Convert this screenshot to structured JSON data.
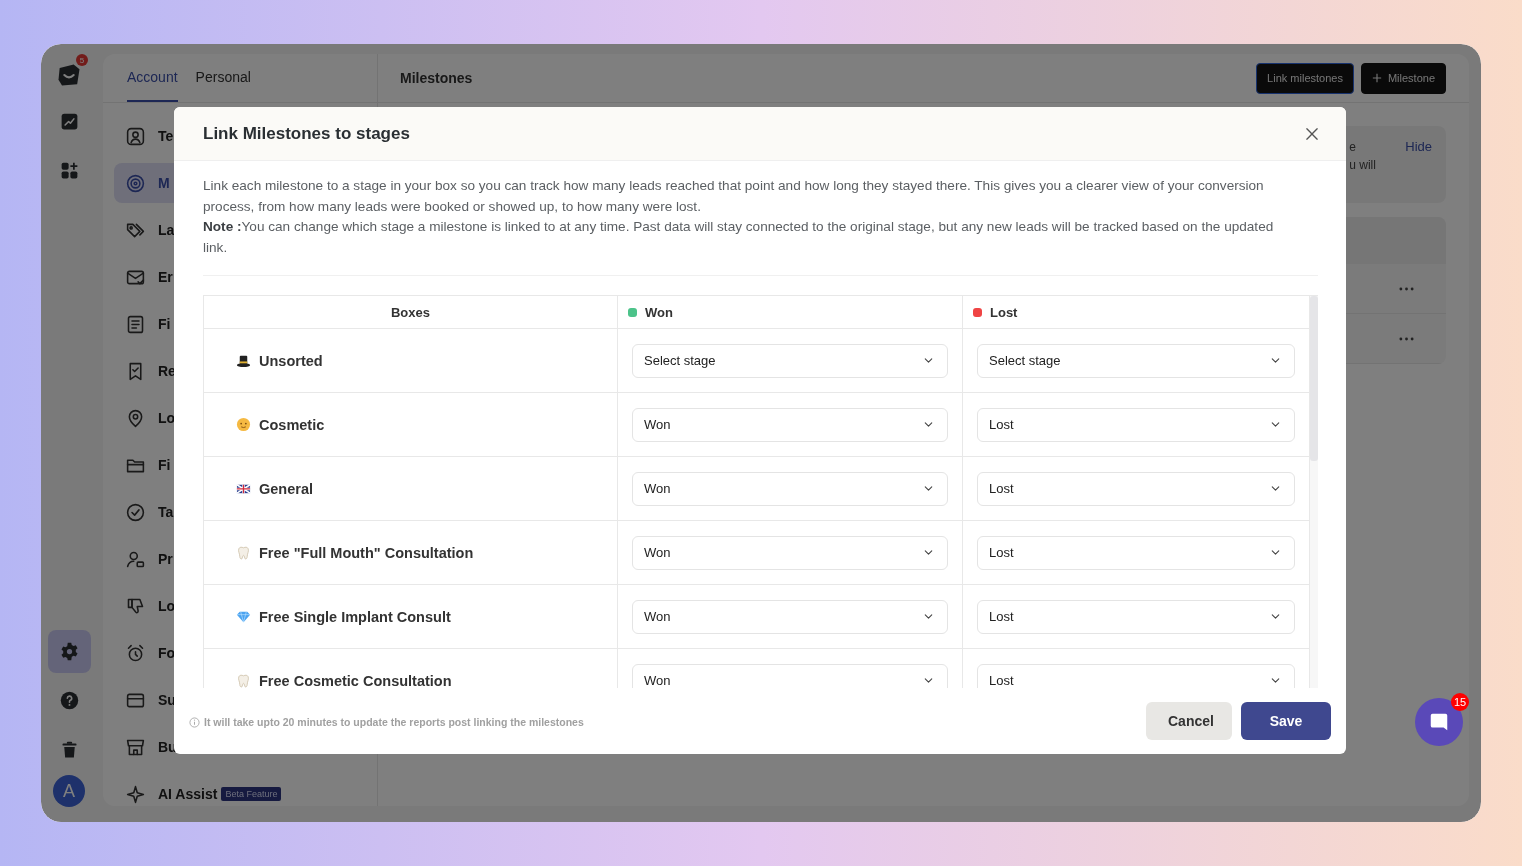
{
  "rail": {
    "logo_badge": "5",
    "top_items": [
      {
        "selected": false
      },
      {
        "selected": false
      }
    ],
    "bottom_items": [
      {
        "selected": true
      },
      {
        "selected": false
      },
      {
        "selected": false
      }
    ],
    "avatar": "A"
  },
  "sidebar": {
    "tabs": [
      {
        "label": "Account",
        "selected": true
      },
      {
        "label": "Personal",
        "selected": false
      }
    ],
    "items": [
      {
        "label": "Te",
        "selected": false
      },
      {
        "label": "M",
        "selected": true
      },
      {
        "label": "La",
        "selected": false
      },
      {
        "label": "Er",
        "selected": false
      },
      {
        "label": "Fi",
        "selected": false
      },
      {
        "label": "Re",
        "selected": false
      },
      {
        "label": "Lo",
        "selected": false
      },
      {
        "label": "Fi",
        "selected": false
      },
      {
        "label": "Ta",
        "selected": false
      },
      {
        "label": "Pr",
        "selected": false
      },
      {
        "label": "Lo",
        "selected": false
      },
      {
        "label": "Fo",
        "selected": false
      },
      {
        "label": "Su",
        "selected": false
      },
      {
        "label": "Bu",
        "selected": false
      },
      {
        "label": "AI Assist",
        "selected": false,
        "badge": "Beta Feature"
      }
    ]
  },
  "main": {
    "title": "Milestones",
    "buttons": [
      {
        "label": "Link milestones",
        "kind": "plain",
        "focused": true
      },
      {
        "label": "Milestone",
        "kind": "add",
        "focused": false
      }
    ],
    "banner": {
      "lines": [
        "e",
        "u will"
      ],
      "action": "Hide"
    },
    "list_rows": [
      {
        "has_menu": true
      },
      {
        "has_menu": true
      }
    ]
  },
  "modal": {
    "title": "Link Milestones to stages",
    "intro": "Link each milestone to a stage in your box so you can track how many leads reached that point and how long they stayed there. This gives you a clearer view of your conversion process, from how many leads were booked or showed up, to how many were lost.",
    "note": "**Note :**You can change which stage a milestone is linked to at any time. Past data will stay connected to the original stage, but any new leads will be tracked based on the updated link.",
    "columns": [
      {
        "label": "Boxes"
      },
      {
        "label": "Won",
        "color": "#4cc38a"
      },
      {
        "label": "Lost",
        "color": "#ef4444"
      }
    ],
    "rows": [
      {
        "name": "Unsorted",
        "won": "Select stage",
        "lost": "Select stage"
      },
      {
        "name": "Cosmetic",
        "won": "Won",
        "lost": "Lost"
      },
      {
        "name": "General",
        "won": "Won",
        "lost": "Lost"
      },
      {
        "name": "Free \"Full Mouth\" Consultation",
        "won": "Won",
        "lost": "Lost"
      },
      {
        "name": "Free Single Implant Consult",
        "won": "Won",
        "lost": "Lost"
      },
      {
        "name": "Free Cosmetic Consultation",
        "won": "Won",
        "lost": "Lost"
      }
    ],
    "footnote": "It will take upto 20 minutes to update the reports post linking the milestones",
    "buttons": [
      {
        "label": "Cancel",
        "kind": "secondary"
      },
      {
        "label": "Save",
        "kind": "primary"
      }
    ]
  },
  "chat": {
    "badge": "15"
  }
}
